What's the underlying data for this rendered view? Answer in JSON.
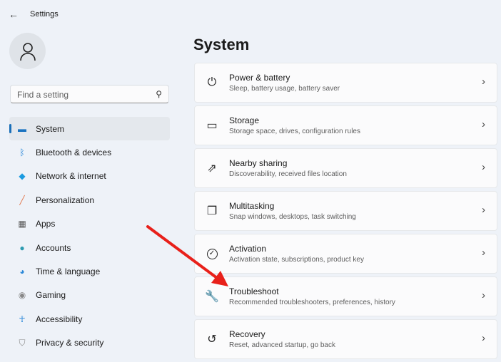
{
  "window": {
    "title": "Settings"
  },
  "search": {
    "placeholder": "Find a setting"
  },
  "page_title": "System",
  "nav": [
    {
      "label": "System",
      "icon": "system-icon",
      "color": "#1a73c0"
    },
    {
      "label": "Bluetooth & devices",
      "icon": "bluetooth-icon",
      "color": "#1a7fd6"
    },
    {
      "label": "Network & internet",
      "icon": "wifi-icon",
      "color": "#1b9be0"
    },
    {
      "label": "Personalization",
      "icon": "brush-icon",
      "color": "#e27a50"
    },
    {
      "label": "Apps",
      "icon": "apps-icon",
      "color": "#555"
    },
    {
      "label": "Accounts",
      "icon": "accounts-icon",
      "color": "#2d9bb0"
    },
    {
      "label": "Time & language",
      "icon": "globe-clock-icon",
      "color": "#2b88d8"
    },
    {
      "label": "Gaming",
      "icon": "gamepad-icon",
      "color": "#888"
    },
    {
      "label": "Accessibility",
      "icon": "accessibility-icon",
      "color": "#1a7fd6"
    },
    {
      "label": "Privacy & security",
      "icon": "shield-icon",
      "color": "#888"
    }
  ],
  "cards": [
    {
      "title": "Power & battery",
      "subtitle": "Sleep, battery usage, battery saver",
      "icon": "power-icon"
    },
    {
      "title": "Storage",
      "subtitle": "Storage space, drives, configuration rules",
      "icon": "storage-icon"
    },
    {
      "title": "Nearby sharing",
      "subtitle": "Discoverability, received files location",
      "icon": "share-icon"
    },
    {
      "title": "Multitasking",
      "subtitle": "Snap windows, desktops, task switching",
      "icon": "multitasking-icon"
    },
    {
      "title": "Activation",
      "subtitle": "Activation state, subscriptions, product key",
      "icon": "check-circle-icon"
    },
    {
      "title": "Troubleshoot",
      "subtitle": "Recommended troubleshooters, preferences, history",
      "icon": "wrench-icon"
    },
    {
      "title": "Recovery",
      "subtitle": "Reset, advanced startup, go back",
      "icon": "recovery-icon"
    }
  ],
  "annotation": {
    "arrow_color": "#e8201a"
  }
}
